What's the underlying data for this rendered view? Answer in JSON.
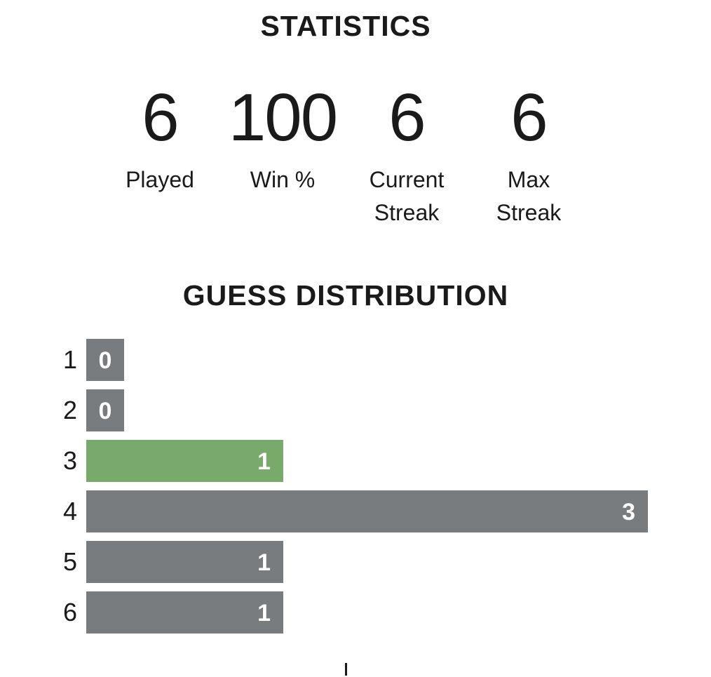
{
  "statistics": {
    "title": "STATISTICS",
    "items": [
      {
        "value": "6",
        "label": "Played"
      },
      {
        "value": "100",
        "label": "Win %"
      },
      {
        "value": "6",
        "label": "Current Streak"
      },
      {
        "value": "6",
        "label": "Max Streak"
      }
    ]
  },
  "distribution": {
    "title": "GUESS DISTRIBUTION",
    "rows": [
      {
        "guess": "1",
        "count": 0,
        "highlight": false
      },
      {
        "guess": "2",
        "count": 0,
        "highlight": false
      },
      {
        "guess": "3",
        "count": 1,
        "highlight": true
      },
      {
        "guess": "4",
        "count": 3,
        "highlight": false
      },
      {
        "guess": "5",
        "count": 1,
        "highlight": false
      },
      {
        "guess": "6",
        "count": 1,
        "highlight": false
      }
    ]
  },
  "colors": {
    "bar": "#787c7e",
    "highlight": "#79a96b",
    "text": "#1a1a1b"
  }
}
